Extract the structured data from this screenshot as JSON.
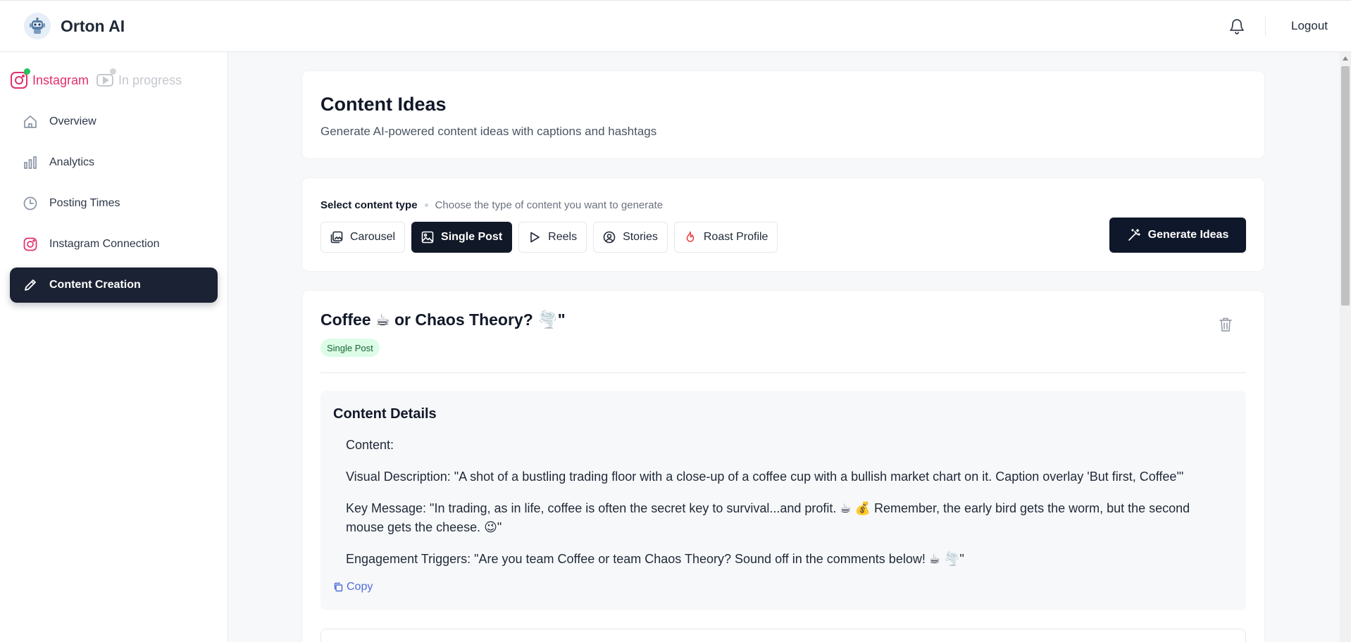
{
  "header": {
    "brand_name": "Orton AI",
    "logout_label": "Logout",
    "icons": {
      "logo": "robot-logo-icon",
      "notifications": "bell-icon"
    }
  },
  "sidebar": {
    "platforms": [
      {
        "label": "Instagram",
        "icon": "instagram-icon",
        "status_dot": "#22c55e",
        "color": "#e1306c"
      },
      {
        "label": "In progress",
        "icon": "youtube-icon",
        "status_dot": "#d1d5db",
        "color": "#c5c8ce"
      }
    ],
    "items": [
      {
        "label": "Overview",
        "icon": "home-icon"
      },
      {
        "label": "Analytics",
        "icon": "bar-chart-icon"
      },
      {
        "label": "Posting Times",
        "icon": "clock-icon"
      },
      {
        "label": "Instagram Connection",
        "icon": "instagram-icon"
      },
      {
        "label": "Content Creation",
        "icon": "pencil-icon",
        "active": true
      }
    ]
  },
  "page": {
    "title": "Content Ideas",
    "subtitle": "Generate AI-powered content ideas with captions and hashtags"
  },
  "content_type": {
    "label": "Select content type",
    "hint": "Choose the type of content you want to generate",
    "options": [
      {
        "label": "Carousel",
        "icon": "gallery-icon"
      },
      {
        "label": "Single Post",
        "icon": "image-icon",
        "selected": true
      },
      {
        "label": "Reels",
        "icon": "play-icon"
      },
      {
        "label": "Stories",
        "icon": "user-circle-icon"
      },
      {
        "label": "Roast Profile",
        "icon": "flame-icon"
      }
    ],
    "generate_label": "Generate Ideas",
    "generate_icon": "magic-wand-icon"
  },
  "idea": {
    "title": "Coffee ☕ or Chaos Theory? 🌪️\"",
    "badge": "Single Post",
    "delete_icon": "trash-icon",
    "details_heading": "Content Details",
    "lines": [
      "Content:",
      "Visual Description: \"A shot of a bustling trading floor with a close-up of a coffee cup with a bullish market chart on it. Caption overlay 'But first, Coffee'\"",
      "Key Message: \"In trading, as in life, coffee is often the secret key to survival...and profit. ☕ 💰 Remember, the early bird gets the worm, but the second mouse gets the cheese. 😉\"",
      "Engagement Triggers: \"Are you team Coffee or team Chaos Theory? Sound off in the comments below! ☕ 🌪️\""
    ],
    "copy_label": "Copy",
    "copy_icon": "copy-icon"
  },
  "colors": {
    "accent_dark": "#111827",
    "instagram": "#e1306c",
    "badge_bg": "#dcfce7",
    "badge_text": "#166534",
    "link": "#4f6bd8"
  }
}
